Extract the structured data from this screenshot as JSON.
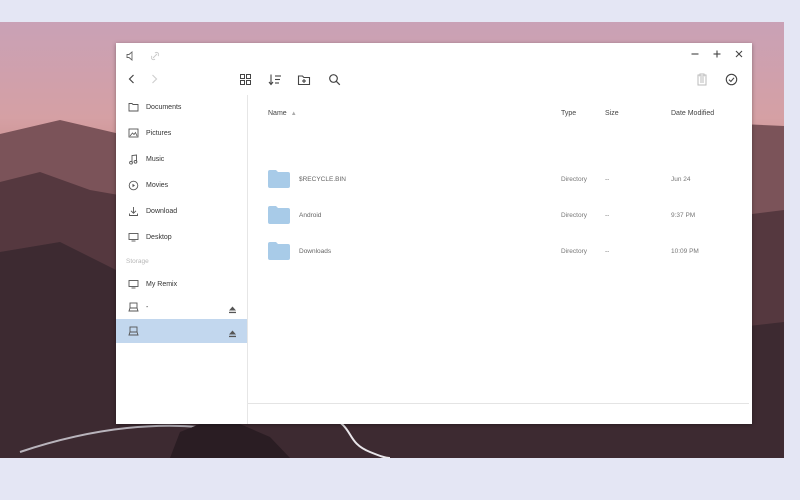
{
  "toolbar": {
    "icons": [
      "back-icon",
      "forward-icon",
      "grid-view-icon",
      "sort-icon",
      "new-folder-icon",
      "search-icon",
      "clipboard-icon",
      "select-check-icon"
    ]
  },
  "titlebar": {
    "icons": [
      "speaker-icon",
      "link-icon",
      "minimize-icon",
      "maximize-icon",
      "close-icon"
    ]
  },
  "sidebar": {
    "places": [
      {
        "label": "Documents",
        "icon": "document-icon"
      },
      {
        "label": "Pictures",
        "icon": "picture-icon"
      },
      {
        "label": "Music",
        "icon": "music-icon"
      },
      {
        "label": "Movies",
        "icon": "movie-icon"
      },
      {
        "label": "Download",
        "icon": "download-icon"
      },
      {
        "label": "Desktop",
        "icon": "desktop-icon"
      }
    ],
    "storage_header": "Storage",
    "storage": [
      {
        "label": "My Remix",
        "icon": "computer-icon"
      },
      {
        "label": "-",
        "icon": "drive-icon",
        "ejectable": true
      },
      {
        "label": "",
        "icon": "drive-icon",
        "ejectable": true,
        "selected": true
      }
    ]
  },
  "columns": {
    "name": "Name",
    "type": "Type",
    "size": "Size",
    "date": "Date Modified"
  },
  "files": [
    {
      "name": "$RECYCLE.BIN",
      "type": "Directory",
      "size": "--",
      "date": "Jun 24"
    },
    {
      "name": "Android",
      "type": "Directory",
      "size": "--",
      "date": "9:37 PM"
    },
    {
      "name": "Downloads",
      "type": "Directory",
      "size": "--",
      "date": "10:09 PM"
    }
  ],
  "colors": {
    "selection": "#c2d7ee",
    "folder": "#a8cbe8",
    "background": "#e4e6f4"
  }
}
